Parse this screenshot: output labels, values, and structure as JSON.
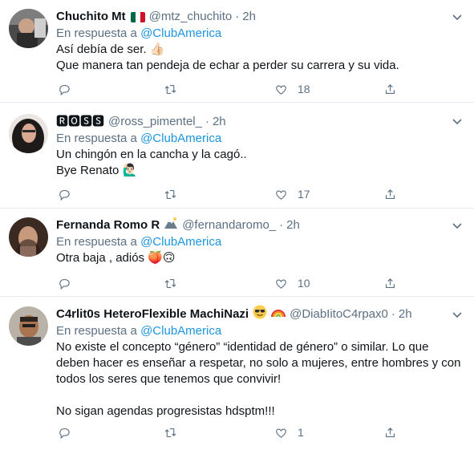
{
  "tweets": [
    {
      "display_name": "Chuchito Mt",
      "handle": "@mtz_chuchito",
      "separator": "·",
      "time": "2h",
      "reply_prefix": "En respuesta a",
      "reply_mention": "@ClubAmerica",
      "lines": [
        "Así debía de ser. 👍🏻",
        "Que manera tan pendeja de echar a perder su carrera y su vida."
      ],
      "reply_count": "",
      "retweet_count": "",
      "like_count": "18"
    },
    {
      "display_name": "🆁🅾🆂🆂",
      "handle": "@ross_pimentel_",
      "separator": "·",
      "time": "2h",
      "reply_prefix": "En respuesta a",
      "reply_mention": "@ClubAmerica",
      "lines": [
        "Un chingón en la cancha y la cagó..",
        "Bye Renato 🙋🏻‍♂️"
      ],
      "reply_count": "",
      "retweet_count": "",
      "like_count": "17"
    },
    {
      "display_name": "Fernanda Romo R",
      "handle": "@fernandaromo_",
      "separator": "·",
      "time": "2h",
      "reply_prefix": "En respuesta a",
      "reply_mention": "@ClubAmerica",
      "lines": [
        "Otra baja , adiós 🍑🙃"
      ],
      "reply_count": "",
      "retweet_count": "",
      "like_count": "10"
    },
    {
      "display_name": "C4rlit0s HeteroFlexible MachiNazi",
      "handle": "@DiabIitoC4rpax0",
      "separator": "·",
      "time": "2h",
      "reply_prefix": "En respuesta a",
      "reply_mention": "@ClubAmerica",
      "lines": [
        "No existe el concepto “género” “identidad de género” o similar. Lo que",
        "deben hacer es enseñar a respetar, no solo a mujeres, entre hombres y con",
        "todos los seres que tenemos que convivir!",
        "",
        "No sigan agendas progresistas hdsptm!!!"
      ],
      "reply_count": "",
      "retweet_count": "",
      "like_count": "1"
    }
  ],
  "icons": {
    "reply": "reply-icon",
    "retweet": "retweet-icon",
    "like": "heart-icon",
    "share": "share-icon",
    "more": "chevron-down-icon"
  },
  "colors": {
    "mention": "#1b95e0",
    "secondary_text": "#5b7083",
    "divider": "#e6ecf0"
  }
}
